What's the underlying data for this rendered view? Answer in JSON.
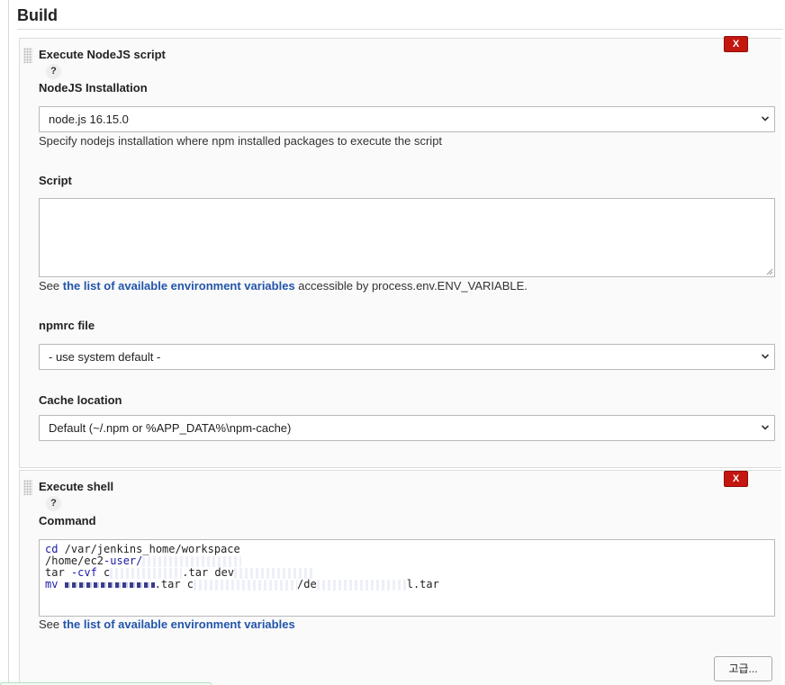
{
  "section": {
    "title": "Build"
  },
  "nodejs_step": {
    "title": "Execute NodeJS script",
    "help": "?",
    "delete_label": "X",
    "installation": {
      "label": "NodeJS Installation",
      "value": "node.js 16.15.0",
      "hint": "Specify nodejs installation where npm installed packages to execute the script"
    },
    "script": {
      "label": "Script",
      "value": "",
      "hint_prefix": "See ",
      "hint_link": "the list of available environment variables",
      "hint_suffix": " accessible by process.env.ENV_VARIABLE."
    },
    "npmrc": {
      "label": "npmrc file",
      "value": "- use system default -"
    },
    "cache": {
      "label": "Cache location",
      "value": "Default (~/.npm or %APP_DATA%\\npm-cache)"
    }
  },
  "shell_step": {
    "title": "Execute shell",
    "help": "?",
    "delete_label": "X",
    "command": {
      "label": "Command",
      "line1_kw": "cd",
      "line1": " /var/jenkins_home/workspace",
      "line2_a": "/home/ec2",
      "line2_kw": "-user/",
      "line3_a": "tar ",
      "line3_kw": "-cvf",
      "line3_b": " c",
      "line3_c": ".tar dev",
      "line4_kw": "mv",
      "line4_a": ".tar c",
      "line4_b": "/de",
      "line4_c": "l.tar",
      "hint_prefix": "See ",
      "hint_link": "the list of available environment variables"
    },
    "advanced_label": "고급..."
  }
}
